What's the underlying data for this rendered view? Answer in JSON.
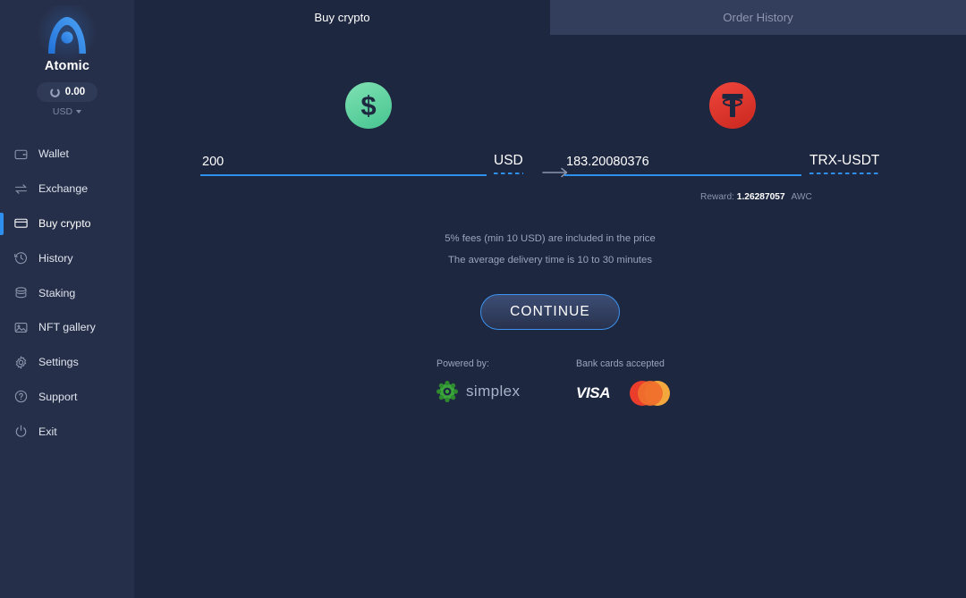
{
  "sidebar": {
    "brand_name": "Atomic",
    "logo_icon": "atomic-logo-icon",
    "balance": "0.00",
    "balance_icon": "loading-donut-icon",
    "currency": "USD",
    "currency_caret_icon": "chevron-down-icon",
    "items": [
      {
        "label": "Wallet",
        "icon": "wallet-icon",
        "active": false
      },
      {
        "label": "Exchange",
        "icon": "exchange-icon",
        "active": false
      },
      {
        "label": "Buy crypto",
        "icon": "card-icon",
        "active": true
      },
      {
        "label": "History",
        "icon": "clock-icon",
        "active": false
      },
      {
        "label": "Staking",
        "icon": "stack-icon",
        "active": false
      },
      {
        "label": "NFT gallery",
        "icon": "image-icon",
        "active": false
      },
      {
        "label": "Settings",
        "icon": "gear-icon",
        "active": false
      },
      {
        "label": "Support",
        "icon": "question-icon",
        "active": false
      },
      {
        "label": "Exit",
        "icon": "power-icon",
        "active": false
      }
    ]
  },
  "tabs": [
    {
      "label": "Buy crypto",
      "active": true
    },
    {
      "label": "Order History",
      "active": false
    }
  ],
  "exchange": {
    "from": {
      "icon": "dollar-coin-icon",
      "amount": "200",
      "placeholder": "0",
      "ticker": "USD"
    },
    "arrow_icon": "arrow-right-icon",
    "to": {
      "icon": "tether-coin-icon",
      "amount": "183.20080376",
      "placeholder": "0",
      "ticker": "TRX-USDT"
    },
    "reward_label": "Reward:",
    "reward_value": "1.26287057",
    "reward_unit": "AWC"
  },
  "notes": [
    "5% fees (min 10 USD) are included in the price",
    "The average delivery time is 10 to 30 minutes"
  ],
  "cta_label": "CONTINUE",
  "footer": {
    "powered_title": "Powered by:",
    "provider_name": "simplex",
    "provider_icon": "simplex-icon",
    "cards_title": "Bank cards accepted",
    "visa_label": "VISA",
    "mastercard_icon": "mastercard-icon"
  },
  "colors": {
    "sidebar_bg": "#262f49",
    "main_bg": "#1e2740",
    "tab_inactive_bg": "#333e5c",
    "accent": "#2f8fef",
    "usd_coin": "#46c48f",
    "usdt_coin": "#d82e24",
    "muted_text": "#9aa4bd"
  }
}
